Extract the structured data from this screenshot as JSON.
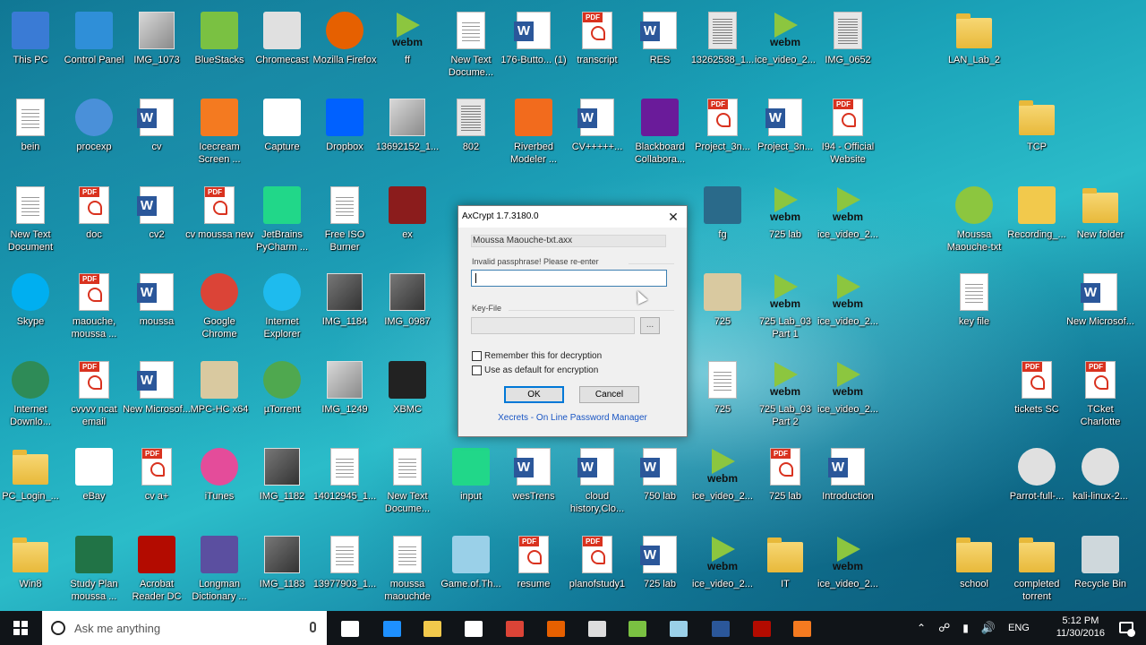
{
  "desktop": {
    "icons": [
      {
        "label": "This PC",
        "type": "sq",
        "color": "#3a7bd5",
        "icon": "computer-icon"
      },
      {
        "label": "Control Panel",
        "type": "sq",
        "color": "#2f8fd8",
        "icon": "control-panel-icon"
      },
      {
        "label": "IMG_1073",
        "type": "photo-light",
        "icon": "photo-icon"
      },
      {
        "label": "BlueStacks",
        "type": "sq",
        "color": "#7ac142",
        "icon": "bluestacks-icon"
      },
      {
        "label": "Chromecast",
        "type": "sq",
        "color": "#e0e0e0",
        "icon": "chromecast-icon"
      },
      {
        "label": "Mozilla Firefox",
        "type": "circle",
        "color": "#e66000",
        "icon": "firefox-icon"
      },
      {
        "label": "ff",
        "type": "webm",
        "icon": "webm-icon"
      },
      {
        "label": "New Text Docume...",
        "type": "doc",
        "icon": "text-document-icon"
      },
      {
        "label": "176-Butto... (1)",
        "type": "word",
        "icon": "word-document-icon"
      },
      {
        "label": "transcript",
        "type": "pdf",
        "icon": "pdf-icon"
      },
      {
        "label": "RES",
        "type": "word",
        "icon": "word-document-icon"
      },
      {
        "label": "13262538_1...",
        "type": "scan",
        "icon": "scan-icon"
      },
      {
        "label": "ice_video_2...",
        "type": "webm",
        "icon": "webm-icon"
      },
      {
        "label": "IMG_0652",
        "type": "scan",
        "icon": "scan-icon"
      },
      {
        "label": "LAN_Lab_2",
        "type": "folder",
        "icon": "folder-icon"
      },
      {
        "label": "bein",
        "type": "doc",
        "icon": "text-document-icon"
      },
      {
        "label": "procexp",
        "type": "circle",
        "color": "#4a90d9",
        "icon": "procexp-icon"
      },
      {
        "label": "cv",
        "type": "word",
        "icon": "word-document-icon"
      },
      {
        "label": "Icecream Screen ...",
        "type": "sq",
        "color": "#f47a20",
        "icon": "icecream-icon"
      },
      {
        "label": "Capture",
        "type": "sq",
        "color": "#ffffff",
        "icon": "image-icon"
      },
      {
        "label": "Dropbox",
        "type": "sq",
        "color": "#0061ff",
        "icon": "dropbox-icon"
      },
      {
        "label": "13692152_1...",
        "type": "photo-light",
        "icon": "photo-icon"
      },
      {
        "label": "802",
        "type": "scan",
        "icon": "scan-icon"
      },
      {
        "label": "Riverbed Modeler ...",
        "type": "sq",
        "color": "#f26b1d",
        "icon": "riverbed-icon"
      },
      {
        "label": "CV+++++...",
        "type": "word",
        "icon": "word-document-icon"
      },
      {
        "label": "Blackboard Collabora...",
        "type": "sq",
        "color": "#6a1b9a",
        "icon": "blackboard-icon"
      },
      {
        "label": "Project_3n...",
        "type": "pdf",
        "icon": "pdf-icon"
      },
      {
        "label": "Project_3n...",
        "type": "word",
        "icon": "word-document-icon"
      },
      {
        "label": "I94 - Official Website",
        "type": "pdf",
        "icon": "pdf-icon"
      },
      {
        "label": "TCP",
        "type": "folder",
        "icon": "folder-icon"
      },
      {
        "label": "New Text Document",
        "type": "doc",
        "icon": "text-document-icon"
      },
      {
        "label": "doc",
        "type": "pdf",
        "icon": "pdf-icon"
      },
      {
        "label": "cv2",
        "type": "word",
        "icon": "word-document-icon"
      },
      {
        "label": "cv moussa new",
        "type": "pdf",
        "icon": "pdf-icon"
      },
      {
        "label": "JetBrains PyCharm ...",
        "type": "sq",
        "color": "#21d789",
        "icon": "pycharm-icon"
      },
      {
        "label": "Free ISO Burner",
        "type": "doc",
        "icon": "iso-icon"
      },
      {
        "label": "ex",
        "type": "sq",
        "color": "#8b1c1c",
        "icon": "winrar-icon"
      },
      {
        "label": "fg",
        "type": "sq",
        "color": "#2a6a8a",
        "icon": "image-icon"
      },
      {
        "label": "725 lab",
        "type": "webm",
        "icon": "webm-icon"
      },
      {
        "label": "ice_video_2...",
        "type": "webm",
        "icon": "webm-icon"
      },
      {
        "label": "Moussa Maouche-txt",
        "type": "circle",
        "color": "#8cc63f",
        "icon": "axcrypt-key-icon"
      },
      {
        "label": "Recording_...",
        "type": "sq",
        "color": "#f2c94c",
        "icon": "recording-icon"
      },
      {
        "label": "New folder",
        "type": "folder",
        "icon": "folder-icon"
      },
      {
        "label": "Skype",
        "type": "circle",
        "color": "#00aff0",
        "icon": "skype-icon"
      },
      {
        "label": "maouche, moussa ...",
        "type": "pdf",
        "icon": "pdf-icon"
      },
      {
        "label": "moussa",
        "type": "word",
        "icon": "word-document-icon"
      },
      {
        "label": "Google Chrome",
        "type": "circle",
        "color": "#db4437",
        "icon": "chrome-icon"
      },
      {
        "label": "Internet Explorer",
        "type": "circle",
        "color": "#1ebbee",
        "icon": "ie-icon"
      },
      {
        "label": "IMG_1184",
        "type": "photo",
        "icon": "photo-icon"
      },
      {
        "label": "IMG_0987",
        "type": "photo",
        "icon": "photo-icon"
      },
      {
        "label": "725",
        "type": "sq",
        "color": "#d9c9a0",
        "icon": "mpc-icon"
      },
      {
        "label": "725 Lab_03 Part 1",
        "type": "webm",
        "icon": "webm-icon"
      },
      {
        "label": "ice_video_2...",
        "type": "webm",
        "icon": "webm-icon"
      },
      {
        "label": "key file",
        "type": "doc",
        "icon": "text-document-icon"
      },
      {
        "label": "New Microsof...",
        "type": "word",
        "icon": "word-document-icon"
      },
      {
        "label": "Internet Downlo...",
        "type": "circle",
        "color": "#2e8b57",
        "icon": "idm-icon"
      },
      {
        "label": "cvvvv ncat email",
        "type": "pdf",
        "icon": "pdf-icon"
      },
      {
        "label": "New Microsof...",
        "type": "word",
        "icon": "word-document-icon"
      },
      {
        "label": "MPC-HC x64",
        "type": "sq",
        "color": "#d9c9a0",
        "icon": "mpc-icon"
      },
      {
        "label": "µTorrent",
        "type": "circle",
        "color": "#4fa84f",
        "icon": "utorrent-icon"
      },
      {
        "label": "IMG_1249",
        "type": "photo-light",
        "icon": "photo-icon"
      },
      {
        "label": "XBMC",
        "type": "sq",
        "color": "#222222",
        "icon": "xbmc-icon"
      },
      {
        "label": "725",
        "type": "doc",
        "icon": "wav-icon"
      },
      {
        "label": "725 Lab_03 Part 2",
        "type": "webm",
        "icon": "webm-icon"
      },
      {
        "label": "ice_video_2...",
        "type": "webm",
        "icon": "webm-icon"
      },
      {
        "label": "tickets SC",
        "type": "pdf",
        "icon": "pdf-icon"
      },
      {
        "label": "TCket Charlotte",
        "type": "pdf",
        "icon": "pdf-icon"
      },
      {
        "label": "PC_Login_...",
        "type": "folder",
        "icon": "folder-icon"
      },
      {
        "label": "eBay",
        "type": "sq",
        "color": "#ffffff",
        "icon": "ebay-icon"
      },
      {
        "label": "cv a+",
        "type": "pdf",
        "icon": "pdf-icon"
      },
      {
        "label": "iTunes",
        "type": "circle",
        "color": "#e44c9a",
        "icon": "itunes-icon"
      },
      {
        "label": "IMG_1182",
        "type": "photo",
        "icon": "photo-icon"
      },
      {
        "label": "14012945_1...",
        "type": "doc",
        "icon": "photo-icon"
      },
      {
        "label": "New Text Docume...",
        "type": "doc",
        "icon": "text-document-icon"
      },
      {
        "label": "input",
        "type": "sq",
        "color": "#21d789",
        "icon": "pycharm-icon"
      },
      {
        "label": "wesTrens",
        "type": "word",
        "icon": "word-document-icon"
      },
      {
        "label": "cloud history,Clo...",
        "type": "word",
        "icon": "word-document-icon"
      },
      {
        "label": "750 lab",
        "type": "word",
        "icon": "word-document-icon"
      },
      {
        "label": "ice_video_2...",
        "type": "webm",
        "icon": "webm-icon"
      },
      {
        "label": "725 lab",
        "type": "pdf",
        "icon": "pdf-icon"
      },
      {
        "label": "Introduction",
        "type": "word",
        "icon": "word-document-icon"
      },
      {
        "label": "Parrot-full-...",
        "type": "circle",
        "color": "#e0e0e0",
        "icon": "disc-icon"
      },
      {
        "label": "kali-linux-2...",
        "type": "circle",
        "color": "#e0e0e0",
        "icon": "disc-icon"
      },
      {
        "label": "Win8",
        "type": "folder",
        "icon": "folder-icon"
      },
      {
        "label": "Study Plan moussa ...",
        "type": "sq",
        "color": "#217346",
        "icon": "excel-icon"
      },
      {
        "label": "Acrobat Reader DC",
        "type": "sq",
        "color": "#b30b00",
        "icon": "acrobat-icon"
      },
      {
        "label": "Longman Dictionary ...",
        "type": "sq",
        "color": "#5b4fa0",
        "icon": "longman-icon"
      },
      {
        "label": "IMG_1183",
        "type": "photo",
        "icon": "photo-icon"
      },
      {
        "label": "13977903_1...",
        "type": "doc",
        "icon": "photo-icon"
      },
      {
        "label": "moussa maouchde",
        "type": "doc",
        "icon": "text-document-icon"
      },
      {
        "label": "Game.of.Th...",
        "type": "sq",
        "color": "#9ad0e8",
        "icon": "notepad-icon"
      },
      {
        "label": "resume",
        "type": "pdf",
        "icon": "pdf-icon"
      },
      {
        "label": "planofstudy1",
        "type": "pdf",
        "icon": "pdf-icon"
      },
      {
        "label": "725 lab",
        "type": "word",
        "icon": "word-document-icon"
      },
      {
        "label": "ice_video_2...",
        "type": "webm",
        "icon": "webm-icon"
      },
      {
        "label": "IT",
        "type": "folder",
        "icon": "folder-icon"
      },
      {
        "label": "ice_video_2...",
        "type": "webm",
        "icon": "webm-icon"
      },
      {
        "label": "school",
        "type": "folder",
        "icon": "folder-icon"
      },
      {
        "label": "completed torrent",
        "type": "folder",
        "icon": "folder-icon"
      },
      {
        "label": "Recycle Bin",
        "type": "sq",
        "color": "#cfd8dc",
        "icon": "recycle-bin-icon"
      }
    ],
    "webm_text": "webm"
  },
  "dialog": {
    "title": "AxCrypt 1.7.3180.0",
    "close_glyph": "✕",
    "file_name": "Moussa Maouche-txt.axx",
    "passphrase_label": "Invalid passphrase! Please re-enter",
    "passphrase_value": "",
    "keyfile_label": "Key-File",
    "keyfile_value": "",
    "browse_label": "...",
    "remember_label": "Remember this for decryption",
    "default_label": "Use as default for encryption",
    "ok_label": "OK",
    "cancel_label": "Cancel",
    "link_text": "Xecrets - On Line Password Manager"
  },
  "taskbar": {
    "search_placeholder": "Ask me anything",
    "apps": [
      {
        "name": "task-view-icon",
        "color": "#ffffff"
      },
      {
        "name": "edge-icon",
        "color": "#1e90ff"
      },
      {
        "name": "file-explorer-icon",
        "color": "#f2c94c"
      },
      {
        "name": "store-icon",
        "color": "#ffffff"
      },
      {
        "name": "chrome-icon",
        "color": "#db4437"
      },
      {
        "name": "firefox-icon",
        "color": "#e66000"
      },
      {
        "name": "paint-icon",
        "color": "#dddddd"
      },
      {
        "name": "bluestacks-icon",
        "color": "#7ac142"
      },
      {
        "name": "notepad-icon",
        "color": "#9ad0e8"
      },
      {
        "name": "word-icon",
        "color": "#2b579a"
      },
      {
        "name": "acrobat-icon",
        "color": "#b30b00"
      },
      {
        "name": "icecream-icon",
        "color": "#f47a20"
      }
    ],
    "tray": {
      "language": "ENG",
      "time": "5:12 PM",
      "date": "11/30/2016"
    }
  }
}
